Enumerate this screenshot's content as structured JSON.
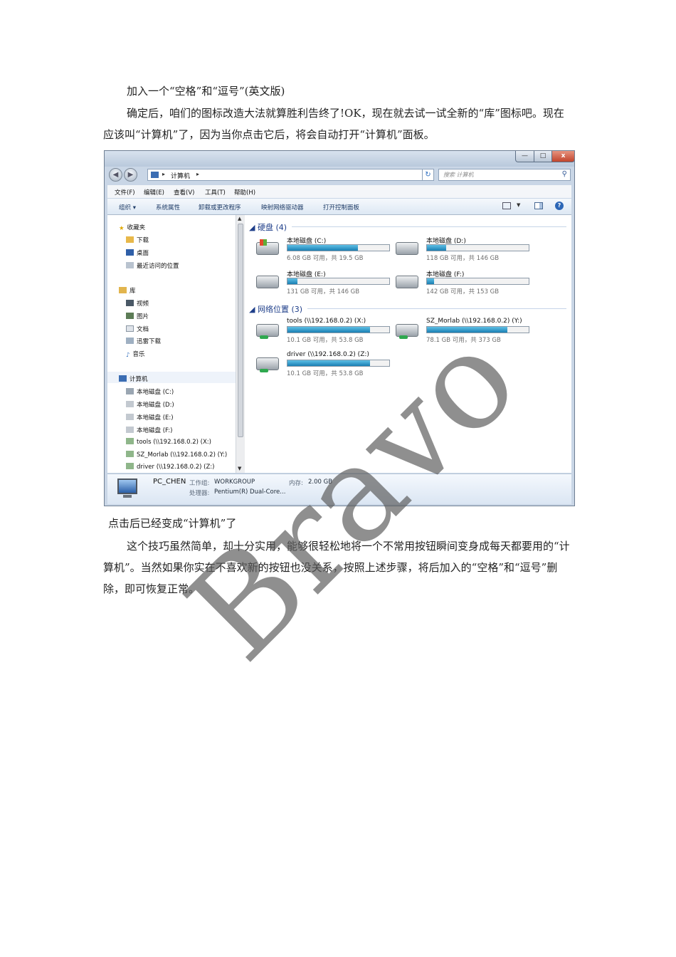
{
  "document": {
    "para1": "加入一个“空格”和“逗号”(英文版)",
    "para2": "确定后，咱们的图标改造大法就算胜利告终了!OK，现在就去试一试全新的“库”图标吧。现在应该叫“计算机”了，因为当你点击它后，将会自动打开“计算机”面板。",
    "caption": "点击后已经变成“计算机”了",
    "para3": "这个技巧虽然简单，却十分实用，能够很轻松地将一个不常用按钮瞬间变身成每天都要用的“计算机”。当然如果你实在不喜欢新的按钮也没关系，按照上述步骤，将后加入的“空格”和“逗号”删除，即可恢复正常。"
  },
  "watermark": "Bravo",
  "explorer": {
    "title_buttons": {
      "minimize": "—",
      "maximize": "□",
      "close": "x"
    },
    "address": {
      "crumb": "计算机",
      "separator": "▸",
      "dropdown": "▾"
    },
    "search": {
      "placeholder": "搜索 计算机"
    },
    "menu": [
      "文件(F)",
      "编辑(E)",
      "查看(V)",
      "工具(T)",
      "帮助(H)"
    ],
    "commands": [
      "组织 ▾",
      "系统属性",
      "卸载或更改程序",
      "映射网络驱动器",
      "打开控制面板"
    ],
    "nav": {
      "favorites": "收藏夹",
      "favorites_items": [
        "下载",
        "桌面",
        "最近访问的位置"
      ],
      "libraries": "库",
      "library_items": [
        "视频",
        "图片",
        "文档",
        "迅雷下载",
        "音乐"
      ],
      "computer": "计算机",
      "computer_items": [
        "本地磁盘 (C:)",
        "本地磁盘 (D:)",
        "本地磁盘 (E:)",
        "本地磁盘 (F:)",
        "tools (\\\\192.168.0.2) (X:)",
        "SZ_Morlab (\\\\192.168.0.2) (Y:)",
        "driver (\\\\192.168.0.2) (Z:)"
      ]
    },
    "groups": {
      "hard_disks": "硬盘 (4)",
      "network": "网络位置 (3)"
    },
    "drives": [
      {
        "name": "本地磁盘 (C:)",
        "info": "6.08 GB 可用，共 19.5 GB",
        "used_fraction": 0.69
      },
      {
        "name": "本地磁盘 (D:)",
        "info": "118 GB 可用，共 146 GB",
        "used_fraction": 0.19
      },
      {
        "name": "本地磁盘 (E:)",
        "info": "131 GB 可用，共 146 GB",
        "used_fraction": 0.1
      },
      {
        "name": "本地磁盘 (F:)",
        "info": "142 GB 可用，共 153 GB",
        "used_fraction": 0.07
      },
      {
        "name": "tools (\\\\192.168.0.2) (X:)",
        "info": "10.1 GB 可用，共 53.8 GB",
        "used_fraction": 0.81
      },
      {
        "name": "SZ_Morlab (\\\\192.168.0.2) (Y:)",
        "info": "78.1 GB 可用，共 373 GB",
        "used_fraction": 0.79
      },
      {
        "name": "driver (\\\\192.168.0.2) (Z:)",
        "info": "10.1 GB 可用，共 53.8 GB",
        "used_fraction": 0.81
      }
    ],
    "details": {
      "pc_name": "PC_CHEN",
      "workgroup_label": "工作组:",
      "workgroup": "WORKGROUP",
      "memory_label": "内存:",
      "memory": "2.00 GB",
      "cpu_label": "处理器:",
      "cpu": "Pentium(R) Dual-Core..."
    }
  }
}
